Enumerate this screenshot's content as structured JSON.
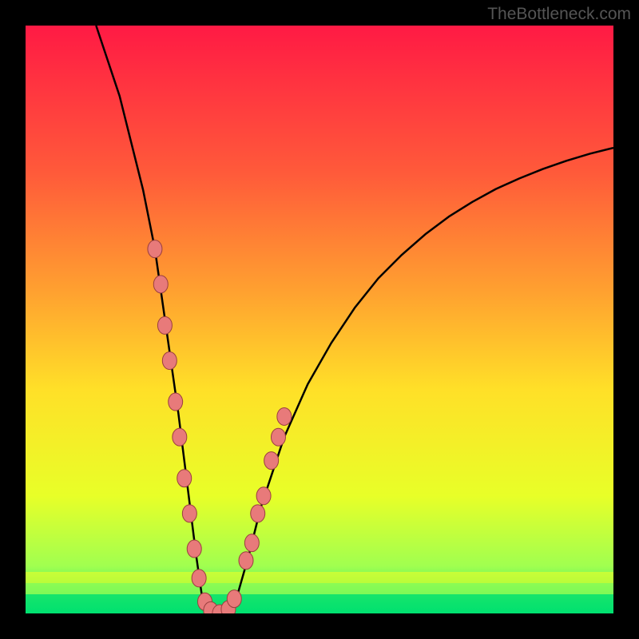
{
  "watermark": "TheBottleneck.com",
  "chart_data": {
    "type": "line",
    "title": "",
    "xlabel": "",
    "ylabel": "",
    "xlim": [
      0,
      100
    ],
    "ylim": [
      0,
      100
    ],
    "gradient_colors": [
      "#ff1a44",
      "#ff5a3a",
      "#ffa030",
      "#ffe028",
      "#e8ff28",
      "#a0ff50",
      "#00e070"
    ],
    "curve": {
      "x": [
        12,
        14,
        16,
        18,
        20,
        22,
        23,
        24,
        25,
        26,
        27,
        28,
        29,
        30,
        32,
        34,
        36,
        38,
        40,
        44,
        48,
        52,
        56,
        60,
        64,
        68,
        72,
        76,
        80,
        84,
        88,
        92,
        96,
        100
      ],
      "y": [
        100,
        94,
        88,
        80,
        72,
        62,
        55,
        48,
        41,
        34,
        26,
        18,
        10,
        3,
        0,
        0,
        3,
        10,
        18,
        30,
        39,
        46,
        52,
        57,
        61,
        64.5,
        67.5,
        70,
        72.2,
        74,
        75.6,
        77,
        78.2,
        79.2
      ]
    },
    "markers": [
      {
        "x": 22.0,
        "y": 62
      },
      {
        "x": 23.0,
        "y": 56
      },
      {
        "x": 23.7,
        "y": 49
      },
      {
        "x": 24.5,
        "y": 43
      },
      {
        "x": 25.5,
        "y": 36
      },
      {
        "x": 26.2,
        "y": 30
      },
      {
        "x": 27.0,
        "y": 23
      },
      {
        "x": 27.9,
        "y": 17
      },
      {
        "x": 28.7,
        "y": 11
      },
      {
        "x": 29.5,
        "y": 6
      },
      {
        "x": 30.5,
        "y": 2
      },
      {
        "x": 31.5,
        "y": 0.5
      },
      {
        "x": 33.0,
        "y": 0
      },
      {
        "x": 34.5,
        "y": 0.7
      },
      {
        "x": 35.5,
        "y": 2.5
      },
      {
        "x": 37.5,
        "y": 9
      },
      {
        "x": 38.5,
        "y": 12
      },
      {
        "x": 39.5,
        "y": 17
      },
      {
        "x": 40.5,
        "y": 20
      },
      {
        "x": 41.8,
        "y": 26
      },
      {
        "x": 43.0,
        "y": 30
      },
      {
        "x": 44.0,
        "y": 33.5
      }
    ],
    "marker_color": "#e87a7a",
    "bottom_band_colors": [
      "#e8ff28",
      "#a0ff50",
      "#00e070"
    ]
  }
}
